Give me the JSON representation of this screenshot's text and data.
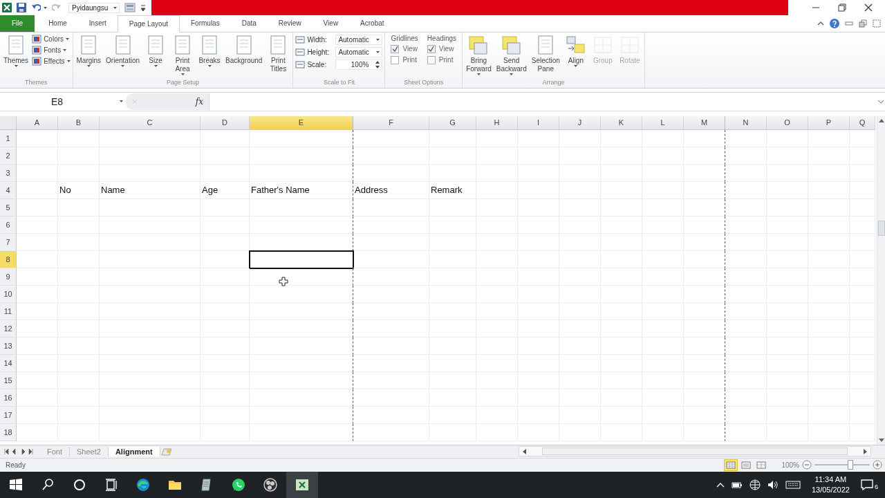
{
  "quick_access": {
    "font_name": "Pyidaungsu"
  },
  "ribbon_tabs": [
    {
      "label": "File",
      "kind": "file",
      "selected": false
    },
    {
      "label": "Home",
      "kind": "tab",
      "selected": false
    },
    {
      "label": "Insert",
      "kind": "tab",
      "selected": false
    },
    {
      "label": "Page Layout",
      "kind": "tab",
      "selected": true
    },
    {
      "label": "Formulas",
      "kind": "tab",
      "selected": false
    },
    {
      "label": "Data",
      "kind": "tab",
      "selected": false
    },
    {
      "label": "Review",
      "kind": "tab",
      "selected": false
    },
    {
      "label": "View",
      "kind": "tab",
      "selected": false
    },
    {
      "label": "Acrobat",
      "kind": "tab",
      "selected": false
    }
  ],
  "ribbon_groups": [
    {
      "label": "Themes",
      "items": [
        {
          "kind": "large",
          "label": "Themes",
          "dropdown": true,
          "disabled": false
        },
        {
          "kind": "stack",
          "entries": [
            {
              "label": "Colors",
              "dropdown": true
            },
            {
              "label": "Fonts",
              "dropdown": true
            },
            {
              "label": "Effects",
              "dropdown": true
            }
          ]
        }
      ]
    },
    {
      "label": "Page Setup",
      "items": [
        {
          "kind": "large",
          "label": "Margins",
          "dropdown": true,
          "disabled": false
        },
        {
          "kind": "large",
          "label": "Orientation",
          "dropdown": true,
          "disabled": false
        },
        {
          "kind": "large",
          "label": "Size",
          "dropdown": true,
          "disabled": false
        },
        {
          "kind": "large",
          "label": "Print\nArea",
          "dropdown": true,
          "disabled": false
        },
        {
          "kind": "large",
          "label": "Breaks",
          "dropdown": true,
          "disabled": false
        },
        {
          "kind": "large",
          "label": "Background",
          "dropdown": false,
          "disabled": false
        },
        {
          "kind": "large",
          "label": "Print\nTitles",
          "dropdown": false,
          "disabled": false
        }
      ]
    },
    {
      "label": "Scale to Fit",
      "items": [
        {
          "kind": "fields",
          "entries": [
            {
              "label": "Width:",
              "value": "Automatic",
              "kind": "dropdown"
            },
            {
              "label": "Height:",
              "value": "Automatic",
              "kind": "dropdown"
            },
            {
              "label": "Scale:",
              "value": "100%",
              "kind": "spinner"
            }
          ]
        }
      ]
    },
    {
      "label": "Sheet Options",
      "items": [
        {
          "kind": "checks",
          "heading": "Gridlines",
          "entries": [
            {
              "label": "View",
              "checked": true
            },
            {
              "label": "Print",
              "checked": false
            }
          ]
        },
        {
          "kind": "checks",
          "heading": "Headings",
          "entries": [
            {
              "label": "View",
              "checked": true
            },
            {
              "label": "Print",
              "checked": false
            }
          ]
        }
      ]
    },
    {
      "label": "Arrange",
      "items": [
        {
          "kind": "large",
          "label": "Bring\nForward",
          "dropdown": true,
          "disabled": false
        },
        {
          "kind": "large",
          "label": "Send\nBackward",
          "dropdown": true,
          "disabled": false
        },
        {
          "kind": "large",
          "label": "Selection\nPane",
          "dropdown": false,
          "disabled": false
        },
        {
          "kind": "large",
          "label": "Align",
          "dropdown": true,
          "disabled": false
        },
        {
          "kind": "large",
          "label": "Group",
          "dropdown": false,
          "disabled": true
        },
        {
          "kind": "large",
          "label": "Rotate",
          "dropdown": false,
          "disabled": true
        }
      ]
    }
  ],
  "formula_bar": {
    "name_box": "E8",
    "function_label": "fx"
  },
  "columns": [
    {
      "label": "A",
      "selected": false,
      "page_break_after": false
    },
    {
      "label": "B",
      "selected": false,
      "page_break_after": false
    },
    {
      "label": "C",
      "selected": false,
      "page_break_after": false
    },
    {
      "label": "D",
      "selected": false,
      "page_break_after": false
    },
    {
      "label": "E",
      "selected": true,
      "page_break_after": true
    },
    {
      "label": "F",
      "selected": false,
      "page_break_after": false
    },
    {
      "label": "G",
      "selected": false,
      "page_break_after": false
    },
    {
      "label": "H",
      "selected": false,
      "page_break_after": false
    },
    {
      "label": "I",
      "selected": false,
      "page_break_after": false
    },
    {
      "label": "J",
      "selected": false,
      "page_break_after": false
    },
    {
      "label": "K",
      "selected": false,
      "page_break_after": false
    },
    {
      "label": "L",
      "selected": false,
      "page_break_after": false
    },
    {
      "label": "M",
      "selected": false,
      "page_break_after": true
    },
    {
      "label": "N",
      "selected": false,
      "page_break_after": false
    },
    {
      "label": "O",
      "selected": false,
      "page_break_after": false
    },
    {
      "label": "P",
      "selected": false,
      "page_break_after": false
    },
    {
      "label": "Q",
      "selected": false,
      "page_break_after": false
    }
  ],
  "rows": [
    {
      "label": "1",
      "selected": false
    },
    {
      "label": "2",
      "selected": false
    },
    {
      "label": "3",
      "selected": false
    },
    {
      "label": "4",
      "selected": false,
      "cells": [
        {},
        {
          "text": "No"
        },
        {
          "text": "Name"
        },
        {
          "text": "Age"
        },
        {
          "text": "Father's Name"
        },
        {
          "text": "Address"
        },
        {
          "text": "Remark"
        }
      ]
    },
    {
      "label": "5",
      "selected": false
    },
    {
      "label": "6",
      "selected": false
    },
    {
      "label": "7",
      "selected": false
    },
    {
      "label": "8",
      "selected": true
    },
    {
      "label": "9",
      "selected": false
    },
    {
      "label": "10",
      "selected": false
    },
    {
      "label": "11",
      "selected": false
    },
    {
      "label": "12",
      "selected": false
    },
    {
      "label": "13",
      "selected": false
    },
    {
      "label": "14",
      "selected": false
    },
    {
      "label": "15",
      "selected": false
    },
    {
      "label": "16",
      "selected": false
    },
    {
      "label": "17",
      "selected": false
    },
    {
      "label": "18",
      "selected": false
    }
  ],
  "sheet_tabs": [
    {
      "label": "Font",
      "selected": false
    },
    {
      "label": "Sheet2",
      "selected": false
    },
    {
      "label": "Alignment",
      "selected": true
    }
  ],
  "status_bar": {
    "status": "Ready",
    "zoom": "100%",
    "zoom_slider": {
      "level": 0.65
    },
    "views": [
      {
        "selected": true
      },
      {
        "selected": false
      },
      {
        "selected": false
      }
    ]
  },
  "taskbar": {
    "time": "11:34 AM",
    "date": "13/05/2022",
    "notifications": "6"
  }
}
